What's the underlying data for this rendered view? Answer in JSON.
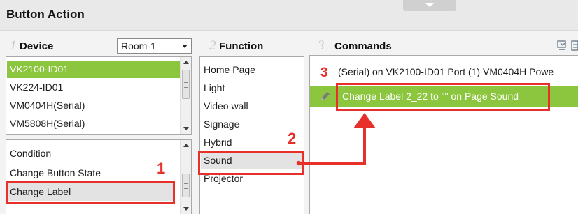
{
  "window": {
    "title": "Button Action"
  },
  "device_panel": {
    "step": "1",
    "heading": "Device",
    "room_select": {
      "value": "Room-1"
    },
    "devices": [
      "VK2100-ID01",
      "VK224-ID01",
      "VM0404H(Serial)",
      "VM5808H(Serial)"
    ],
    "selected_device": "VK2100-ID01",
    "actions": [
      "Condition",
      "Change Button State",
      "Change Label"
    ],
    "selected_action": "Change Label"
  },
  "function_panel": {
    "step": "2",
    "heading": "Function",
    "functions": [
      "Home Page",
      "Light",
      "Video wall",
      "Signage",
      "Hybrid",
      "Sound",
      "Projector"
    ],
    "selected_function": "Sound"
  },
  "commands_panel": {
    "step": "3",
    "heading": "Commands",
    "commands": [
      "(Serial) on VK2100-ID01 Port (1) VM0404H Powe",
      "Change Label 2_22 to \"\" on Page Sound"
    ],
    "selected_command": "Change Label 2_22 to \"\" on Page Sound"
  },
  "annotations": {
    "marker_1": "1",
    "marker_2": "2",
    "marker_3": "3"
  },
  "colors": {
    "selection_green": "#8cc63f",
    "annotation_red": "#e8302b",
    "selection_grey": "#e3e3e3"
  },
  "icons": [
    "pencil-icon",
    "import-icon",
    "export-icon",
    "scroll-up-icon",
    "scroll-down-icon",
    "dropdown-arrow-icon"
  ]
}
